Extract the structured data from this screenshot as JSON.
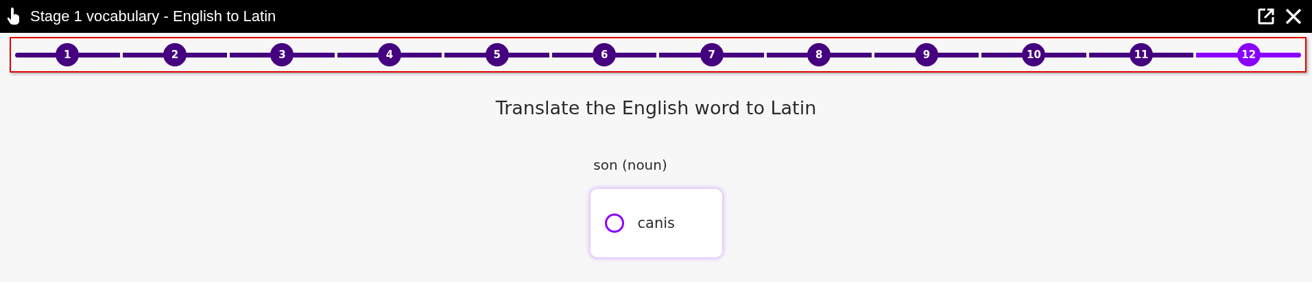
{
  "window": {
    "title": "Stage 1 vocabulary - English to Latin"
  },
  "steps": [
    {
      "label": "1",
      "selected": false
    },
    {
      "label": "2",
      "selected": false
    },
    {
      "label": "3",
      "selected": false
    },
    {
      "label": "4",
      "selected": false
    },
    {
      "label": "5",
      "selected": false
    },
    {
      "label": "6",
      "selected": false
    },
    {
      "label": "7",
      "selected": false
    },
    {
      "label": "8",
      "selected": false
    },
    {
      "label": "9",
      "selected": false
    },
    {
      "label": "10",
      "selected": false
    },
    {
      "label": "11",
      "selected": false
    },
    {
      "label": "12",
      "selected": true
    }
  ],
  "question": {
    "instruction": "Translate the English word to Latin",
    "prompt": "son (noun)"
  },
  "options": [
    {
      "label": "canis",
      "selected": false
    }
  ]
}
